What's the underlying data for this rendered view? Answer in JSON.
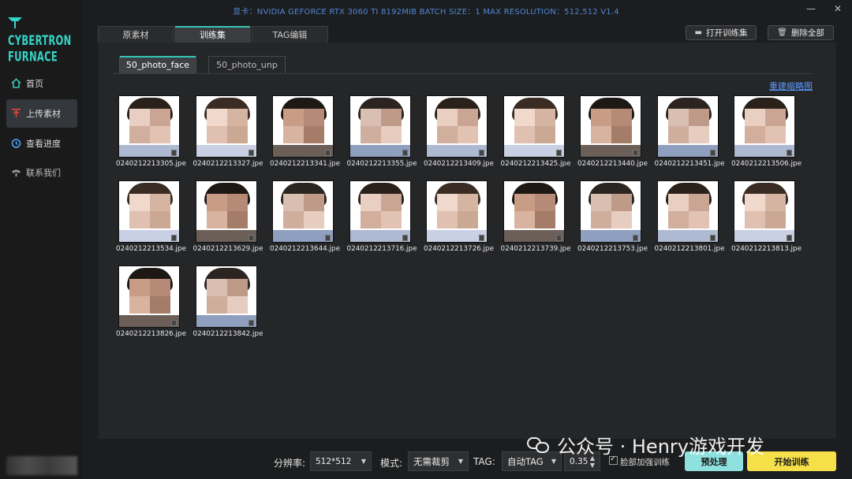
{
  "window": {
    "title": "显卡：NVIDIA GEFORCE RTX 3060 TI 8192MIB  BATCH SIZE：1  MAX RESOLUTION：512,512 V1.4",
    "minimize": "—",
    "close": "✕"
  },
  "sidebar": {
    "logo_text": "CYBERTRON FURNACE",
    "items": [
      {
        "label": "首页",
        "icon": "home-icon"
      },
      {
        "label": "上传素材",
        "icon": "upload-icon"
      },
      {
        "label": "查看进度",
        "icon": "progress-icon"
      },
      {
        "label": "联系我们",
        "icon": "contact-icon"
      }
    ]
  },
  "tabs": [
    {
      "label": "原素材"
    },
    {
      "label": "训练集"
    },
    {
      "label": "TAG编辑"
    }
  ],
  "actions": {
    "open_training_set": "打开训练集",
    "delete_all": "删除全部"
  },
  "subtabs": [
    {
      "label": "50_photo_face"
    },
    {
      "label": "50_photo_unp"
    }
  ],
  "rebuild_thumbnails": "重建缩略图",
  "images": [
    {
      "file": "0240212213305.jpe"
    },
    {
      "file": "0240212213327.jpe"
    },
    {
      "file": "0240212213341.jpe"
    },
    {
      "file": "0240212213355.jpe"
    },
    {
      "file": "0240212213409.jpe"
    },
    {
      "file": "0240212213425.jpe"
    },
    {
      "file": "0240212213440.jpe"
    },
    {
      "file": "0240212213451.jpe"
    },
    {
      "file": "0240212213506.jpe"
    },
    {
      "file": "0240212213534.jpe"
    },
    {
      "file": "0240212213629.jpe"
    },
    {
      "file": "0240212213644.jpe"
    },
    {
      "file": "0240212213716.jpe"
    },
    {
      "file": "0240212213726.jpe"
    },
    {
      "file": "0240212213739.jpe"
    },
    {
      "file": "0240212213753.jpe"
    },
    {
      "file": "0240212213801.jpe"
    },
    {
      "file": "0240212213813.jpe"
    },
    {
      "file": "0240212213826.jpe"
    },
    {
      "file": "0240212213842.jpe"
    }
  ],
  "bottom": {
    "resolution_label": "分辨率:",
    "resolution_value": "512*512",
    "mode_label": "模式:",
    "mode_value": "无需裁剪",
    "tag_label": "TAG:",
    "tag_value": "自动TAG",
    "threshold_value": "0.35",
    "face_train_label": "脸部加强训练",
    "preprocess_button": "预处理",
    "start_button": "开始训练"
  },
  "watermark_text": "公众号 · Henry游戏开发",
  "colors": {
    "accent": "#35c6b6",
    "link": "#5b9bff",
    "preprocess_bg": "#8ee1de",
    "start_bg": "#f5e04a",
    "title_text": "#4e86d6"
  }
}
